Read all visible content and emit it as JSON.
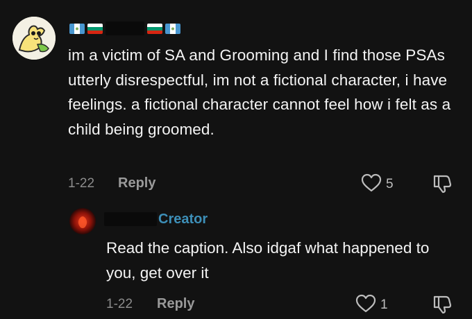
{
  "comment": {
    "text": "im a victim of SA and Grooming and I find those PSAs utterly disrespectful, im not a fictional character, i have feelings. a fictional character cannot feel how i felt as a child being groomed.",
    "date": "1-22",
    "reply_label": "Reply",
    "like_count": "5"
  },
  "reply": {
    "badge": "Creator",
    "text": "Read the caption. Also idgaf what happened to you, get over it",
    "date": "1-22",
    "reply_label": "Reply",
    "like_count": "1"
  },
  "colors": {
    "background": "#121212",
    "creator_badge": "#3d8fb8",
    "meta_text": "#8c8c8c"
  },
  "icons": {
    "like": "heart-outline-icon",
    "dislike": "thumbs-down-icon"
  }
}
